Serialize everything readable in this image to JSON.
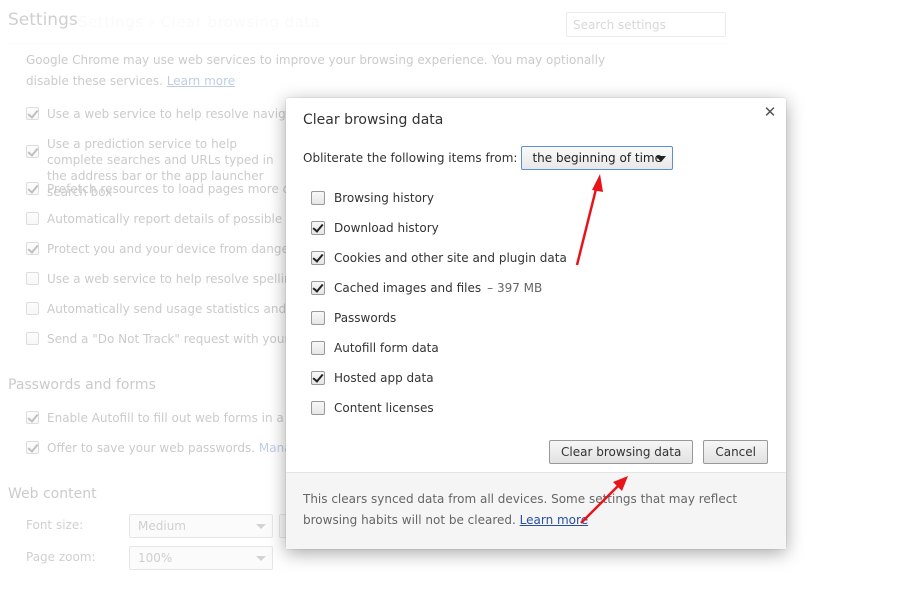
{
  "page": {
    "title": "Settings",
    "ghost_breadcrumb": "Settings  ›  Clear browsing data",
    "search_placeholder": "Search settings",
    "intro_text": "Google Chrome may use web services to improve your browsing experience. You may optionally disable these services.",
    "intro_link": "Learn more",
    "privacy_options": [
      {
        "label": "Use a web service to help resolve navigation errors",
        "checked": true
      },
      {
        "label": "Use a prediction service to help complete searches and URLs typed in the address bar or the app launcher search box",
        "checked": true
      },
      {
        "label": "Prefetch resources to load pages more quickly",
        "checked": true
      },
      {
        "label": "Automatically report details of possible security incidents to Google",
        "checked": false
      },
      {
        "label": "Protect you and your device from dangerous sites",
        "checked": true
      },
      {
        "label": "Use a web service to help resolve spelling errors",
        "checked": false
      },
      {
        "label": "Automatically send usage statistics and crash reports to Google",
        "checked": false
      },
      {
        "label": "Send a \"Do Not Track\" request with your browsing traffic",
        "checked": false
      }
    ],
    "passwords_section": {
      "heading": "Passwords and forms",
      "options": [
        {
          "label": "Enable Autofill to fill out web forms in a single click.",
          "checked": true
        },
        {
          "label": "Offer to save your web passwords.",
          "link": "Manage passwords",
          "checked": true
        }
      ]
    },
    "web_content_section": {
      "heading": "Web content",
      "font_size_label": "Font size:",
      "font_size_value": "Medium",
      "page_zoom_label": "Page zoom:",
      "page_zoom_value": "100%"
    }
  },
  "dialog": {
    "title": "Clear browsing data",
    "close_icon": "close-icon",
    "from_label": "Obliterate the following items from:",
    "time_range_value": "the beginning of time",
    "items": [
      {
        "label": "Browsing history",
        "checked": false
      },
      {
        "label": "Download history",
        "checked": true
      },
      {
        "label": "Cookies and other site and plugin data",
        "checked": true
      },
      {
        "label": "Cached images and files",
        "size": "–  397 MB",
        "checked": true
      },
      {
        "label": "Passwords",
        "checked": false
      },
      {
        "label": "Autofill form data",
        "checked": false
      },
      {
        "label": "Hosted app data",
        "checked": true
      },
      {
        "label": "Content licenses",
        "checked": false
      }
    ],
    "clear_button": "Clear browsing data",
    "cancel_button": "Cancel",
    "footer_text": "This clears synced data from all devices. Some settings that may reflect browsing habits will not be cleared.",
    "footer_link": "Learn more"
  },
  "annotations": {
    "arrow_color": "#e8141a"
  }
}
